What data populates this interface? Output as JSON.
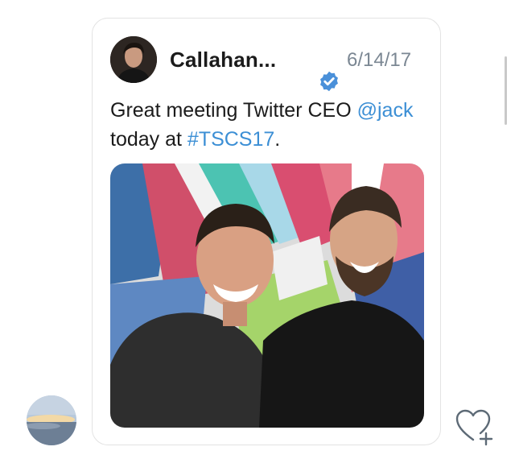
{
  "tweet": {
    "author_name": "Callahan...",
    "verified_icon": "verified-badge-icon",
    "date": "6/14/17",
    "text_before": "Great meeting Twitter CEO",
    "mention": "@jack",
    "text_middle": "today at",
    "hashtag": "#TSCS17",
    "text_end": ".",
    "link_color": "#3c8fd5"
  },
  "icons": {
    "like": "heart-plus-icon"
  },
  "colors": {
    "verified": "#4a90d9",
    "date": "#7b8793",
    "text": "#1b1b1b"
  }
}
